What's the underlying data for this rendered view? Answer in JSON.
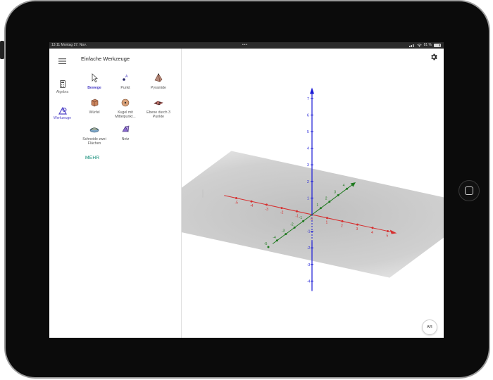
{
  "status_bar": {
    "time_date": "13:11  Montag 27. Nov.",
    "center_dots": "•••",
    "indicators": "81 %",
    "icons": [
      "signal-icon",
      "wifi-icon",
      "battery-icon"
    ]
  },
  "rail": {
    "items": [
      {
        "label": "Algebra",
        "icon": "calculator-icon",
        "active": false
      },
      {
        "label": "Werkzeuge",
        "icon": "tools-icon",
        "active": true
      }
    ],
    "menu_icon": "hamburger-menu-icon"
  },
  "panel": {
    "title": "Einfache Werkzeuge",
    "tools": [
      {
        "label": "Bewege",
        "icon": "move-arrow-icon",
        "active": true
      },
      {
        "label": "Punkt",
        "icon": "point-icon",
        "active": false
      },
      {
        "label": "Pyramide",
        "icon": "pyramid-icon",
        "active": false
      },
      {
        "label": "Würfel",
        "icon": "cube-icon",
        "active": false
      },
      {
        "label": "Kugel mit Mittelpunkt...",
        "icon": "sphere-icon",
        "active": false
      },
      {
        "label": "Ebene durch 3 Punkte",
        "icon": "plane-three-points-icon",
        "active": false
      },
      {
        "label": "Schneide zwei Flächen",
        "icon": "intersect-surfaces-icon",
        "active": false
      },
      {
        "label": "Netz",
        "icon": "net-icon",
        "active": false
      }
    ],
    "more_label": "MEHR"
  },
  "view3d": {
    "settings_icon": "gear-icon",
    "ar_label": "AR",
    "axis_colors": {
      "x": "#d62f2f",
      "y": "#1f7a1f",
      "z": "#1a1ad6"
    },
    "z_ticks": [
      "7",
      "6",
      "5",
      "4",
      "3",
      "2",
      "1",
      "-1",
      "-2",
      "-3",
      "-4"
    ],
    "x_ticks": [
      "-5",
      "-4",
      "-3",
      "-2",
      "-1",
      "0",
      "1",
      "2",
      "3",
      "4",
      "5"
    ],
    "y_ticks": [
      "-5",
      "-4",
      "-3",
      "-2",
      "-1",
      "1",
      "2",
      "3",
      "4"
    ]
  },
  "colors": {
    "accent": "#5145c8",
    "more": "#00856f"
  }
}
